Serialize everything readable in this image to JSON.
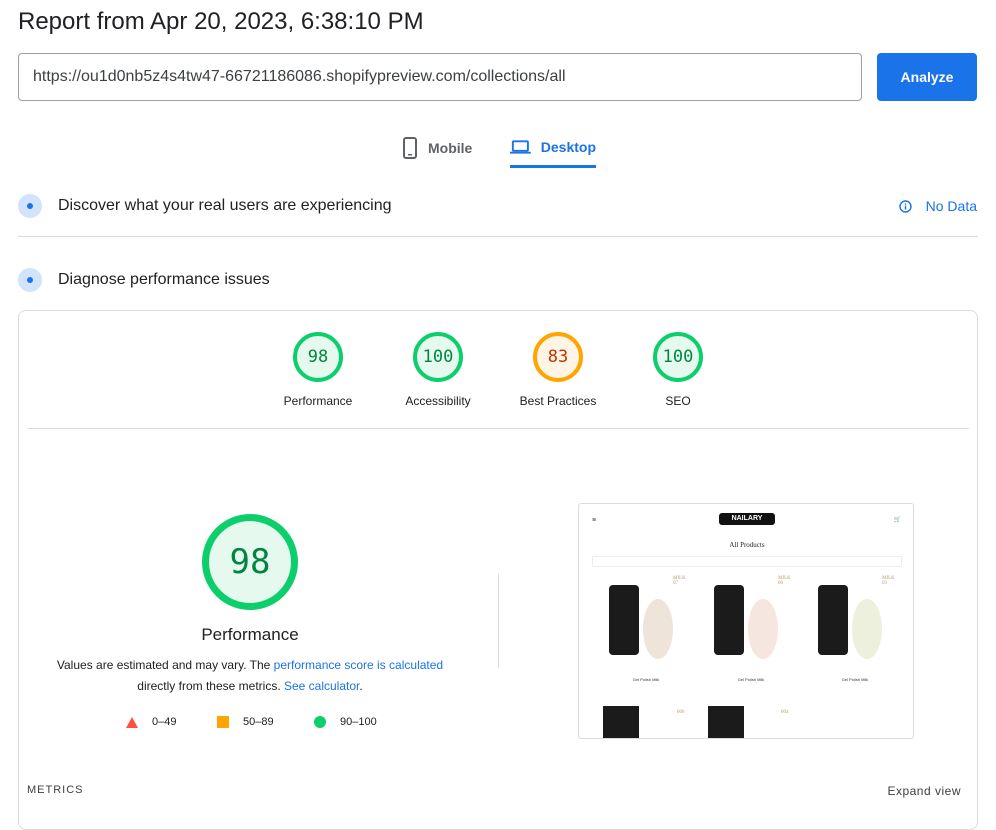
{
  "header": {
    "title": "Report from Apr 20, 2023, 6:38:10 PM",
    "url": "https://ou1d0nb5z4s4tw47-66721186086.shopifypreview.com/collections/all",
    "analyze_label": "Analyze"
  },
  "tabs": [
    {
      "label": "Mobile",
      "icon": "phone-icon"
    },
    {
      "label": "Desktop",
      "icon": "laptop-icon",
      "active": true
    }
  ],
  "field_section": {
    "title": "Discover what your real users are experiencing",
    "status": "No Data"
  },
  "lab_section": {
    "title": "Diagnose performance issues"
  },
  "scores": [
    {
      "label": "Performance",
      "value": "98",
      "color": "#0cce6b"
    },
    {
      "label": "Accessibility",
      "value": "100",
      "color": "#0cce6b"
    },
    {
      "label": "Best Practices",
      "value": "83",
      "color": "#ffa400"
    },
    {
      "label": "SEO",
      "value": "100",
      "color": "#0cce6b"
    }
  ],
  "main_score": {
    "value": "98",
    "label": "Performance",
    "note_prefix": "Values are estimated and may vary. The ",
    "note_link1": "performance score is calculated",
    "note_mid": "directly from these metrics. ",
    "note_link2": "See calculator",
    "note_suffix": "."
  },
  "legend": [
    {
      "range": "0–49",
      "color": "#ff4e42"
    },
    {
      "range": "50–89",
      "color": "#ffa400"
    },
    {
      "range": "90–100",
      "color": "#0cce6b"
    }
  ],
  "screenshot": {
    "logo": "NAILARY",
    "heading": "All Products",
    "products": [
      {
        "badge": "MILK 07"
      },
      {
        "badge": "MILK 06"
      },
      {
        "badge": "MILK 03"
      },
      {
        "badge": "006"
      },
      {
        "badge": "004"
      }
    ]
  },
  "footer": {
    "metrics_label": "METRICS",
    "expand_label": "Expand view"
  }
}
